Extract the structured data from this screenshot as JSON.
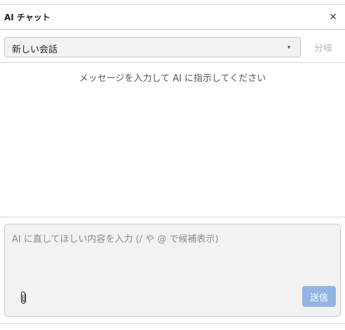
{
  "window": {
    "title": "AI チャット",
    "close_label": "×"
  },
  "toolbar": {
    "conversation_select": {
      "selected": "新しい会話",
      "caret_icon": "▾"
    },
    "branch_label": "分岐"
  },
  "messages": {
    "empty_hint": "メッセージを入力して AI に指示してください"
  },
  "composer": {
    "placeholder": "AI に直してほしい内容を入力 (/ や @ で候補表示)",
    "value": "",
    "attach_icon": "paperclip-icon",
    "send_label": "送信"
  },
  "colors": {
    "send_button": "#93b4e4",
    "border": "#d6d6d6",
    "input_bg": "#f2f2f2",
    "disabled_text": "#b3b3b3"
  }
}
